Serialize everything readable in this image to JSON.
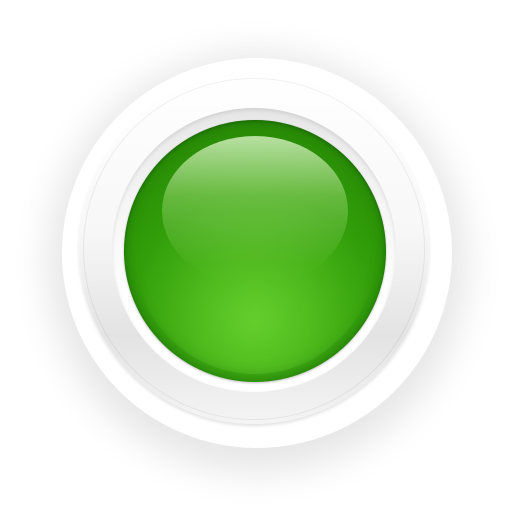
{
  "button": {
    "label": "",
    "state": "on",
    "colors": {
      "button_green": "#3aa80e",
      "button_dark_green": "#237c04",
      "highlight": "#c8efae",
      "bezel": "#f4f4f4",
      "background": "#ffffff"
    }
  }
}
